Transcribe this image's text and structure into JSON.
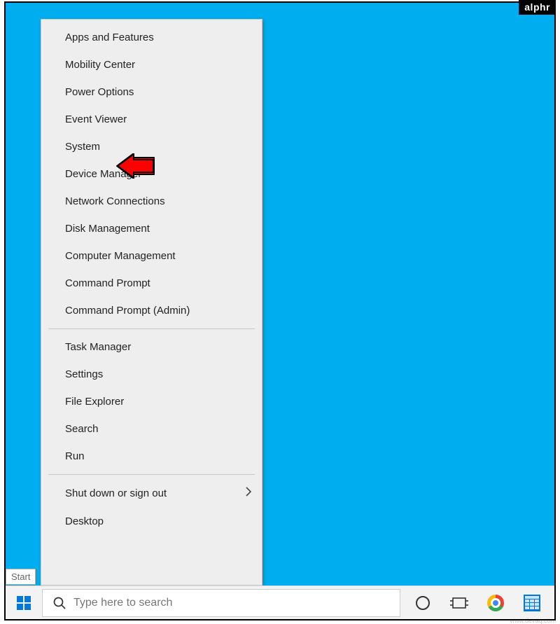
{
  "badge": "alphr",
  "watermark": "www.devaq.com",
  "start_tooltip": "Start",
  "search": {
    "placeholder": "Type here to search"
  },
  "menu": {
    "group1": [
      "Apps and Features",
      "Mobility Center",
      "Power Options",
      "Event Viewer",
      "System",
      "Device Manager",
      "Network Connections",
      "Disk Management",
      "Computer Management",
      "Command Prompt",
      "Command Prompt (Admin)"
    ],
    "group2": [
      "Task Manager",
      "Settings",
      "File Explorer",
      "Search",
      "Run"
    ],
    "group3_parent": "Shut down or sign out",
    "group3_last": "Desktop"
  },
  "tray": {
    "cortana": "cortana-icon",
    "taskview": "task-view-icon",
    "chrome": "chrome-icon",
    "calculator": "calculator-icon"
  }
}
